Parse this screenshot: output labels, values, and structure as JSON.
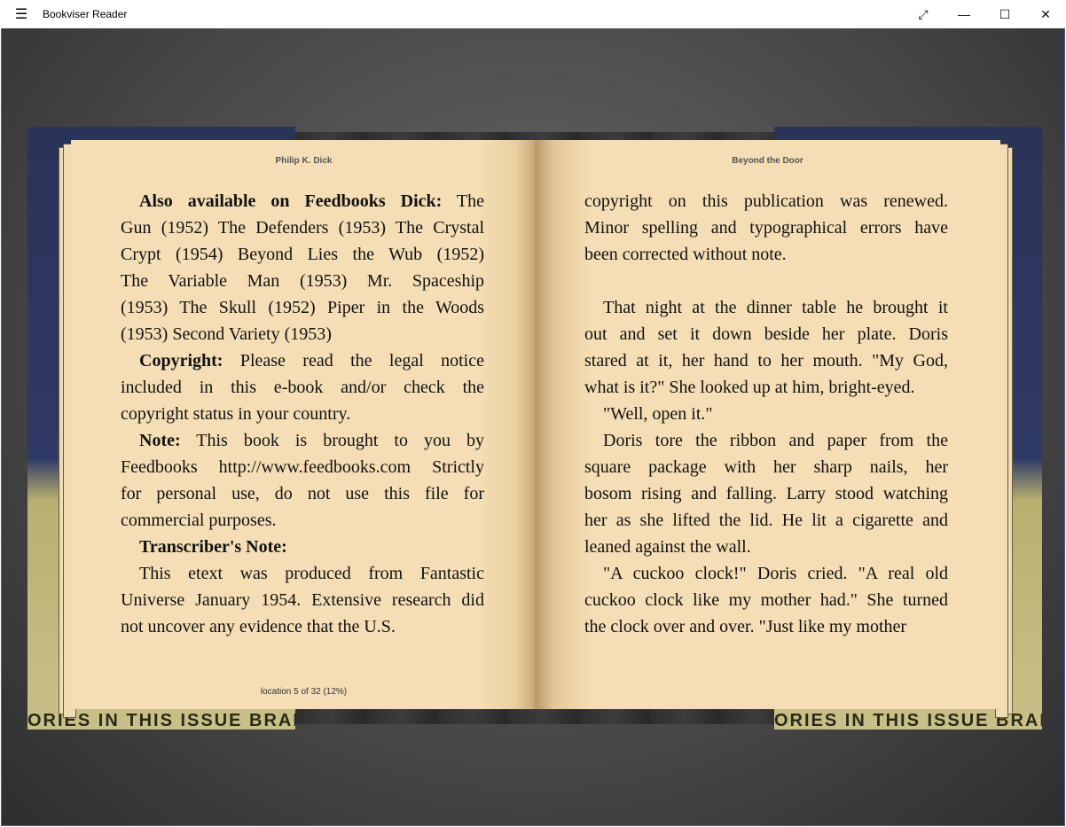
{
  "app": {
    "title": "Bookviser Reader",
    "menu_icon": "hamburger-icon",
    "window_buttons": [
      "fullscreen-icon",
      "minimize-icon",
      "maximize-icon",
      "close-icon"
    ]
  },
  "cover": {
    "left_strip": "ORIES IN THIS ISSUE BRAND",
    "right_strip": "ORIES IN THIS ISSUE BRAND"
  },
  "left_page": {
    "header": "Philip K. Dick",
    "footer": "location 5 of 32 (12%)",
    "lines": [
      {
        "b": "Also  available  on  Feedbooks  Dick:",
        "t": " The",
        "indent": true,
        "justify": true
      },
      {
        "t": "Gun (1952) The Defenders (1953) The Crystal",
        "justify": true
      },
      {
        "t": "Crypt (1954) Beyond Lies the Wub (1952)",
        "justify": true
      },
      {
        "t": "The Variable Man (1953) Mr. Spaceship",
        "justify": true
      },
      {
        "t": "(1953) The Skull (1952) Piper in the Woods",
        "justify": true
      },
      {
        "t": "(1953) Second Variety (1953)"
      },
      {
        "b": "Copyright:",
        "t": " Please read the legal notice",
        "indent": true,
        "justify": true
      },
      {
        "t": "included in this e-book and/or check the",
        "justify": true
      },
      {
        "t": "copyright status in your country."
      },
      {
        "b": "Note:",
        "t": " This book is brought to you by",
        "indent": true,
        "justify": true
      },
      {
        "t": "Feedbooks http://www.feedbooks.com Strictly",
        "justify": true
      },
      {
        "t": "for personal use, do not use this file for",
        "justify": true
      },
      {
        "t": "commercial purposes."
      },
      {
        "b": "Transcriber's Note:",
        "t": "",
        "indent": true
      },
      {
        "t": "This etext was produced from Fantastic",
        "indent": true,
        "justify": true
      },
      {
        "t": "Universe January 1954. Extensive research did",
        "justify": true
      },
      {
        "t": "not uncover any evidence that the U.S."
      }
    ]
  },
  "right_page": {
    "header": "Beyond the Door",
    "lines": [
      {
        "t": "copyright on this publication was renewed.",
        "justify": true
      },
      {
        "t": "Minor spelling and typographical errors have",
        "justify": true
      },
      {
        "t": "been corrected without note."
      },
      {
        "t": ""
      },
      {
        "t": "That night at the dinner table he brought it",
        "indent": true,
        "justify": true
      },
      {
        "t": "out and set it down beside her plate. Doris",
        "justify": true
      },
      {
        "t": "stared at it, her hand to her mouth. \"My God,",
        "justify": true
      },
      {
        "t": "what is it?\" She looked up at him, bright-eyed."
      },
      {
        "t": "\"Well, open it.\"",
        "indent": true
      },
      {
        "t": "Doris tore the ribbon and paper from the",
        "indent": true,
        "justify": true
      },
      {
        "t": "square package with her sharp nails, her",
        "justify": true
      },
      {
        "t": "bosom rising and falling. Larry stood watching",
        "justify": true
      },
      {
        "t": "her as she lifted the lid. He lit a cigarette and",
        "justify": true
      },
      {
        "t": "leaned against the wall."
      },
      {
        "t": "\"A cuckoo clock!\" Doris cried. \"A real old",
        "indent": true,
        "justify": true
      },
      {
        "t": "cuckoo clock like my mother had.\" She turned",
        "justify": true
      },
      {
        "t": "the clock over and over. \"Just like my mother"
      }
    ]
  }
}
